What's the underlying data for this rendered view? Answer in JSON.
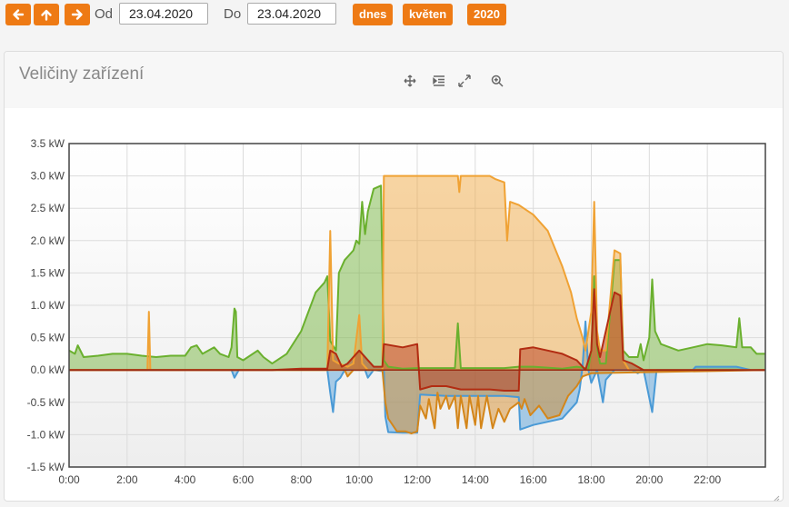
{
  "toolbar": {
    "prev_icon": "arrow-left-icon",
    "up_icon": "arrow-up-icon",
    "next_icon": "arrow-right-icon",
    "from_label": "Od",
    "from_value": "23.04.2020",
    "to_label": "Do",
    "to_value": "23.04.2020",
    "quick": [
      "dnes",
      "květen",
      "2020"
    ],
    "accent": "#ee7a14"
  },
  "panel": {
    "title": "Veličiny zařízení",
    "tools": [
      "move-icon",
      "indent-icon",
      "expand-icon",
      "zoom-icon"
    ]
  },
  "chart_data": {
    "type": "area",
    "x_unit": "hours",
    "xlim": [
      0,
      24
    ],
    "ylim": [
      -1.5,
      3.5
    ],
    "y_ticks": [
      "-1.5 kW",
      "-1.0 kW",
      "-0.5 kW",
      "0.0 kW",
      "0.5 kW",
      "1.0 kW",
      "1.5 kW",
      "2.0 kW",
      "2.5 kW",
      "3.0 kW",
      "3.5 kW"
    ],
    "x_ticks": [
      "0:00",
      "2:00",
      "4:00",
      "6:00",
      "8:00",
      "10:00",
      "12:00",
      "14:00",
      "16:00",
      "18:00",
      "20:00",
      "22:00"
    ],
    "grid": true,
    "series": [
      {
        "color": "#4a9ad6",
        "points": [
          [
            0,
            0
          ],
          [
            5.6,
            0
          ],
          [
            5.7,
            -0.12
          ],
          [
            5.85,
            0
          ],
          [
            8.9,
            0
          ],
          [
            9.0,
            -0.35
          ],
          [
            9.1,
            -0.65
          ],
          [
            9.2,
            -0.18
          ],
          [
            9.35,
            -0.12
          ],
          [
            9.5,
            0
          ],
          [
            10.2,
            0
          ],
          [
            10.3,
            -0.12
          ],
          [
            10.5,
            0
          ],
          [
            10.85,
            -0.02
          ],
          [
            10.9,
            -0.72
          ],
          [
            11.0,
            -0.96
          ],
          [
            11.5,
            -0.97
          ],
          [
            12.0,
            -0.97
          ],
          [
            12.1,
            -0.38
          ],
          [
            13.0,
            -0.4
          ],
          [
            14.0,
            -0.4
          ],
          [
            15.0,
            -0.4
          ],
          [
            15.5,
            -0.42
          ],
          [
            15.55,
            -0.92
          ],
          [
            16.0,
            -0.85
          ],
          [
            16.5,
            -0.8
          ],
          [
            17.0,
            -0.75
          ],
          [
            17.5,
            -0.5
          ],
          [
            17.6,
            -0.3
          ],
          [
            17.7,
            0.05
          ],
          [
            17.8,
            0.75
          ],
          [
            17.9,
            0
          ],
          [
            18.0,
            -0.2
          ],
          [
            18.2,
            0
          ],
          [
            18.4,
            -0.5
          ],
          [
            18.5,
            -0.15
          ],
          [
            18.8,
            0
          ],
          [
            19.0,
            0
          ],
          [
            19.4,
            0
          ],
          [
            19.6,
            -0.05
          ],
          [
            19.8,
            0
          ],
          [
            20.1,
            -0.65
          ],
          [
            20.25,
            0
          ],
          [
            21.5,
            0
          ],
          [
            21.6,
            0.05
          ],
          [
            22.0,
            0.05
          ],
          [
            23.0,
            0.05
          ],
          [
            23.5,
            0
          ],
          [
            24,
            0
          ]
        ]
      },
      {
        "color": "#6ab02e",
        "points": [
          [
            0,
            0.3
          ],
          [
            0.2,
            0.25
          ],
          [
            0.3,
            0.38
          ],
          [
            0.5,
            0.2
          ],
          [
            1.0,
            0.22
          ],
          [
            1.5,
            0.25
          ],
          [
            2.0,
            0.25
          ],
          [
            2.5,
            0.22
          ],
          [
            3.0,
            0.2
          ],
          [
            3.5,
            0.22
          ],
          [
            4.0,
            0.22
          ],
          [
            4.2,
            0.35
          ],
          [
            4.4,
            0.38
          ],
          [
            4.6,
            0.25
          ],
          [
            5.0,
            0.35
          ],
          [
            5.2,
            0.25
          ],
          [
            5.5,
            0.2
          ],
          [
            5.6,
            0.35
          ],
          [
            5.7,
            0.95
          ],
          [
            5.75,
            0.9
          ],
          [
            5.8,
            0.2
          ],
          [
            6.0,
            0.15
          ],
          [
            6.5,
            0.3
          ],
          [
            6.7,
            0.2
          ],
          [
            7.0,
            0.1
          ],
          [
            7.5,
            0.25
          ],
          [
            8.0,
            0.6
          ],
          [
            8.5,
            1.2
          ],
          [
            8.8,
            1.35
          ],
          [
            8.9,
            1.45
          ],
          [
            9.0,
            0.45
          ],
          [
            9.2,
            0.3
          ],
          [
            9.3,
            1.5
          ],
          [
            9.5,
            1.7
          ],
          [
            9.8,
            1.85
          ],
          [
            9.9,
            2.0
          ],
          [
            10.0,
            1.95
          ],
          [
            10.1,
            2.6
          ],
          [
            10.2,
            2.1
          ],
          [
            10.3,
            2.45
          ],
          [
            10.5,
            2.8
          ],
          [
            10.75,
            2.85
          ],
          [
            10.85,
            0.15
          ],
          [
            11.0,
            0.05
          ],
          [
            11.5,
            0.02
          ],
          [
            12.0,
            0.03
          ],
          [
            13.0,
            0.03
          ],
          [
            13.3,
            0.03
          ],
          [
            13.4,
            0.72
          ],
          [
            13.5,
            0.03
          ],
          [
            14.0,
            0.03
          ],
          [
            14.5,
            0.03
          ],
          [
            15.0,
            0.03
          ],
          [
            15.5,
            0.05
          ],
          [
            16.0,
            0.05
          ],
          [
            17.0,
            0.02
          ],
          [
            17.5,
            0.05
          ],
          [
            17.9,
            0.02
          ],
          [
            18.0,
            0.3
          ],
          [
            18.1,
            1.45
          ],
          [
            18.2,
            0.35
          ],
          [
            18.3,
            0.1
          ],
          [
            18.5,
            0.1
          ],
          [
            18.8,
            1.7
          ],
          [
            19.0,
            1.7
          ],
          [
            19.1,
            0.3
          ],
          [
            19.3,
            0.2
          ],
          [
            19.6,
            0.2
          ],
          [
            19.7,
            0.4
          ],
          [
            19.8,
            0.15
          ],
          [
            20.0,
            0.5
          ],
          [
            20.1,
            1.4
          ],
          [
            20.2,
            0.6
          ],
          [
            20.4,
            0.4
          ],
          [
            21.0,
            0.3
          ],
          [
            21.5,
            0.35
          ],
          [
            22.0,
            0.4
          ],
          [
            22.5,
            0.38
          ],
          [
            23.0,
            0.35
          ],
          [
            23.1,
            0.8
          ],
          [
            23.2,
            0.35
          ],
          [
            23.5,
            0.35
          ],
          [
            23.7,
            0.25
          ],
          [
            24,
            0.25
          ]
        ]
      },
      {
        "color": "#f0a234",
        "points": [
          [
            0,
            0
          ],
          [
            2.7,
            0
          ],
          [
            2.75,
            0.9
          ],
          [
            2.8,
            0
          ],
          [
            8.9,
            0
          ],
          [
            9.0,
            2.15
          ],
          [
            9.1,
            0.15
          ],
          [
            9.3,
            0.1
          ],
          [
            9.6,
            0.05
          ],
          [
            9.8,
            0.1
          ],
          [
            10.0,
            0.85
          ],
          [
            10.1,
            0.1
          ],
          [
            10.3,
            0
          ],
          [
            10.5,
            0
          ],
          [
            10.8,
            0
          ],
          [
            10.85,
            3.0
          ],
          [
            12.0,
            3.0
          ],
          [
            13.0,
            3.0
          ],
          [
            13.4,
            3.0
          ],
          [
            13.45,
            2.75
          ],
          [
            13.5,
            3.0
          ],
          [
            14.0,
            3.0
          ],
          [
            14.5,
            3.0
          ],
          [
            14.7,
            2.95
          ],
          [
            15.0,
            2.9
          ],
          [
            15.1,
            2.0
          ],
          [
            15.2,
            2.6
          ],
          [
            15.5,
            2.55
          ],
          [
            16.0,
            2.4
          ],
          [
            16.5,
            2.15
          ],
          [
            17.0,
            1.6
          ],
          [
            17.3,
            1.2
          ],
          [
            17.5,
            0.8
          ],
          [
            17.7,
            0.5
          ],
          [
            17.8,
            0.3
          ],
          [
            18.0,
            0.9
          ],
          [
            18.1,
            2.6
          ],
          [
            18.2,
            0.6
          ],
          [
            18.3,
            0.3
          ],
          [
            18.5,
            0.3
          ],
          [
            18.8,
            1.85
          ],
          [
            19.0,
            1.8
          ],
          [
            19.1,
            0.15
          ],
          [
            19.3,
            0
          ],
          [
            24,
            0
          ]
        ]
      },
      {
        "color": "#d4861a",
        "points": [
          [
            0,
            0
          ],
          [
            9.5,
            0
          ],
          [
            9.6,
            -0.1
          ],
          [
            9.8,
            0
          ],
          [
            10.8,
            0
          ],
          [
            10.9,
            -0.5
          ],
          [
            11.0,
            -0.75
          ],
          [
            11.3,
            -0.95
          ],
          [
            11.6,
            -0.95
          ],
          [
            11.8,
            -0.98
          ],
          [
            12.0,
            -0.95
          ],
          [
            12.1,
            -0.55
          ],
          [
            12.3,
            -0.75
          ],
          [
            12.4,
            -0.45
          ],
          [
            12.6,
            -0.9
          ],
          [
            12.7,
            -0.35
          ],
          [
            12.8,
            -0.6
          ],
          [
            13.0,
            -0.4
          ],
          [
            13.1,
            -0.6
          ],
          [
            13.3,
            -0.4
          ],
          [
            13.4,
            -0.9
          ],
          [
            13.5,
            -0.4
          ],
          [
            13.7,
            -0.9
          ],
          [
            13.8,
            -0.4
          ],
          [
            14.0,
            -0.85
          ],
          [
            14.1,
            -0.4
          ],
          [
            14.2,
            -0.9
          ],
          [
            14.4,
            -0.4
          ],
          [
            14.6,
            -0.9
          ],
          [
            14.8,
            -0.6
          ],
          [
            15.0,
            -0.8
          ],
          [
            15.2,
            -0.6
          ],
          [
            15.5,
            -0.5
          ],
          [
            15.6,
            -0.6
          ],
          [
            15.7,
            -0.45
          ],
          [
            15.9,
            -0.7
          ],
          [
            16.2,
            -0.55
          ],
          [
            16.5,
            -0.75
          ],
          [
            16.9,
            -0.7
          ],
          [
            17.2,
            -0.4
          ],
          [
            17.5,
            -0.25
          ],
          [
            17.7,
            -0.1
          ],
          [
            18.0,
            -0.05
          ],
          [
            24,
            0
          ]
        ]
      },
      {
        "color": "#b22c12",
        "points": [
          [
            0,
            0
          ],
          [
            7.0,
            0
          ],
          [
            8.0,
            0.02
          ],
          [
            8.9,
            0.02
          ],
          [
            9.0,
            0.3
          ],
          [
            9.2,
            0.25
          ],
          [
            9.4,
            0.05
          ],
          [
            9.6,
            0.1
          ],
          [
            10.0,
            0.3
          ],
          [
            10.5,
            0.05
          ],
          [
            10.8,
            0.05
          ],
          [
            10.85,
            0.4
          ],
          [
            11.5,
            0.35
          ],
          [
            12.0,
            0.4
          ],
          [
            12.1,
            -0.3
          ],
          [
            12.5,
            -0.25
          ],
          [
            13.0,
            -0.25
          ],
          [
            13.5,
            -0.3
          ],
          [
            14.0,
            -0.3
          ],
          [
            14.5,
            -0.3
          ],
          [
            15.0,
            -0.32
          ],
          [
            15.5,
            -0.32
          ],
          [
            15.55,
            0.32
          ],
          [
            16.0,
            0.35
          ],
          [
            16.5,
            0.3
          ],
          [
            17.0,
            0.25
          ],
          [
            17.5,
            0.15
          ],
          [
            17.7,
            0.05
          ],
          [
            17.8,
            0
          ],
          [
            18.0,
            0.3
          ],
          [
            18.1,
            1.25
          ],
          [
            18.2,
            0.4
          ],
          [
            18.3,
            0.2
          ],
          [
            18.8,
            1.2
          ],
          [
            19.0,
            1.15
          ],
          [
            19.1,
            0.15
          ],
          [
            19.4,
            0.1
          ],
          [
            19.8,
            0
          ],
          [
            24,
            0
          ]
        ]
      }
    ]
  }
}
